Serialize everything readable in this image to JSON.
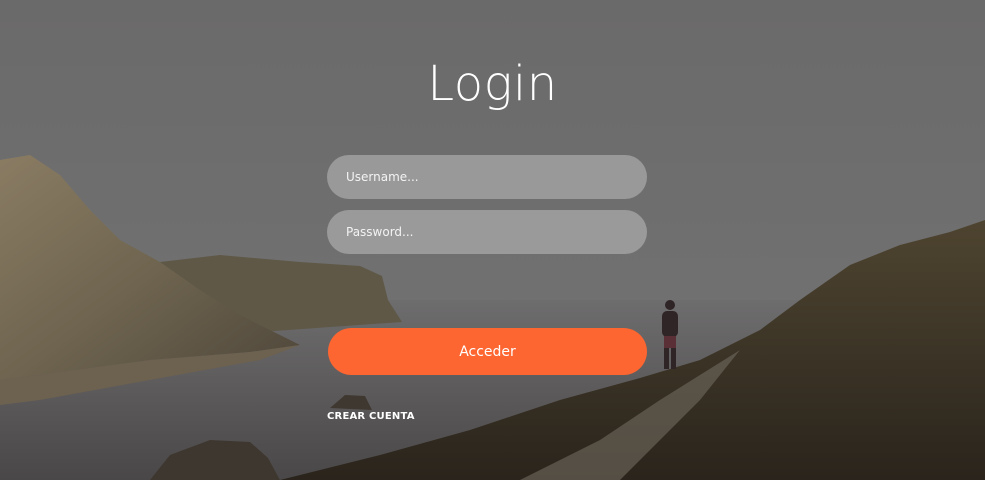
{
  "page": {
    "title": "Login"
  },
  "form": {
    "username_placeholder": "Username...",
    "password_placeholder": "Password...",
    "submit_label": "Acceder",
    "create_account_label": "CREAR CUENTA"
  },
  "colors": {
    "accent": "#fd6531",
    "overlay": "#6c6b6b",
    "field_bg": "#9c9b9b"
  }
}
